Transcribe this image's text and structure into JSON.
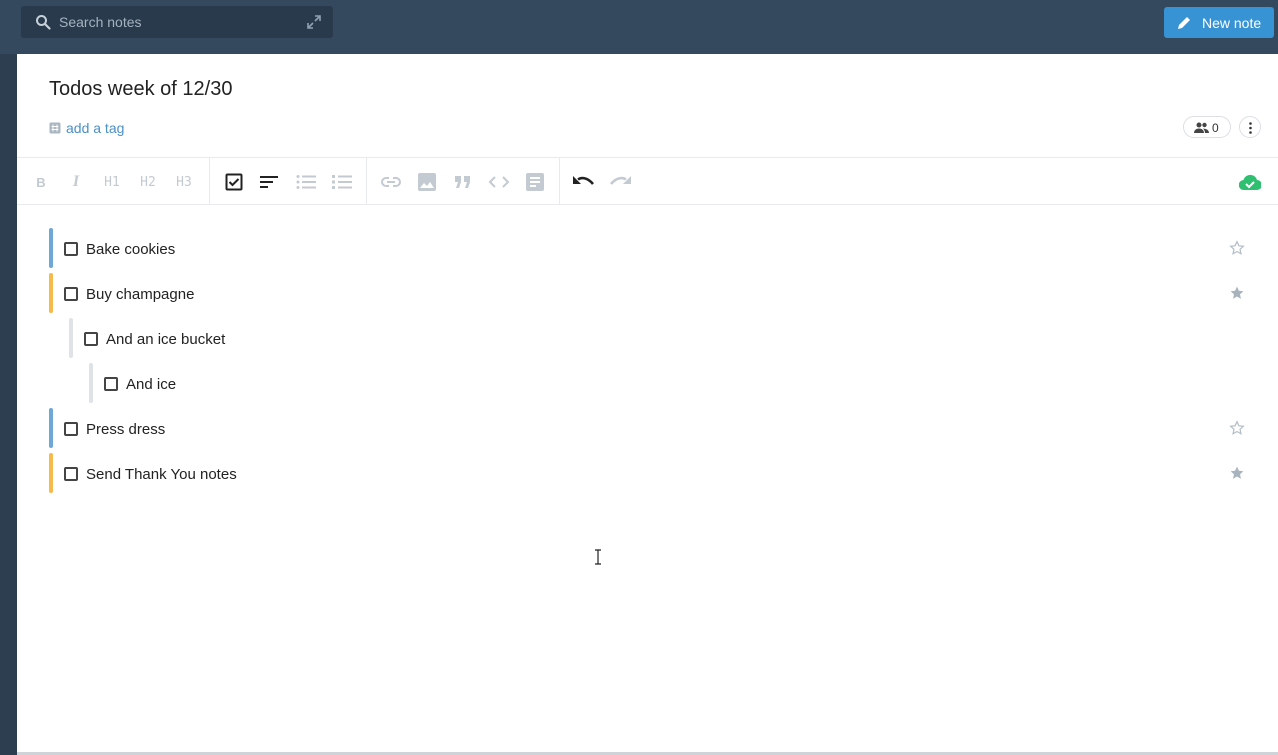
{
  "search": {
    "placeholder": "Search notes",
    "icon": "search-icon"
  },
  "new_note": {
    "label": "New note",
    "color": "#3793d4"
  },
  "note": {
    "title": "Todos week of 12/30",
    "tag_label": "add a tag",
    "collaborators_count": "0"
  },
  "toolbar": {
    "text_buttons": [
      "B",
      "I",
      "H1",
      "H2",
      "H3"
    ]
  },
  "todos": [
    {
      "label": "Bake cookies",
      "starred": false,
      "accent": "#6fa7d6",
      "indent": 0
    },
    {
      "label": "Buy champagne",
      "starred": true,
      "accent": "#f5b94c",
      "indent": 0
    },
    {
      "label": "And an ice bucket",
      "starred": false,
      "accent": "#dfe3e7",
      "indent": 1
    },
    {
      "label": "And ice",
      "starred": false,
      "accent": "#dfe3e7",
      "indent": 2
    },
    {
      "label": "Press dress",
      "starred": false,
      "accent": "#6fa7d6",
      "indent": 0
    },
    {
      "label": "Send Thank You notes",
      "starred": true,
      "accent": "#f5b94c",
      "indent": 0
    }
  ],
  "colors": {
    "sync_ok": "#2fbf71",
    "link": "#4a90c9"
  }
}
